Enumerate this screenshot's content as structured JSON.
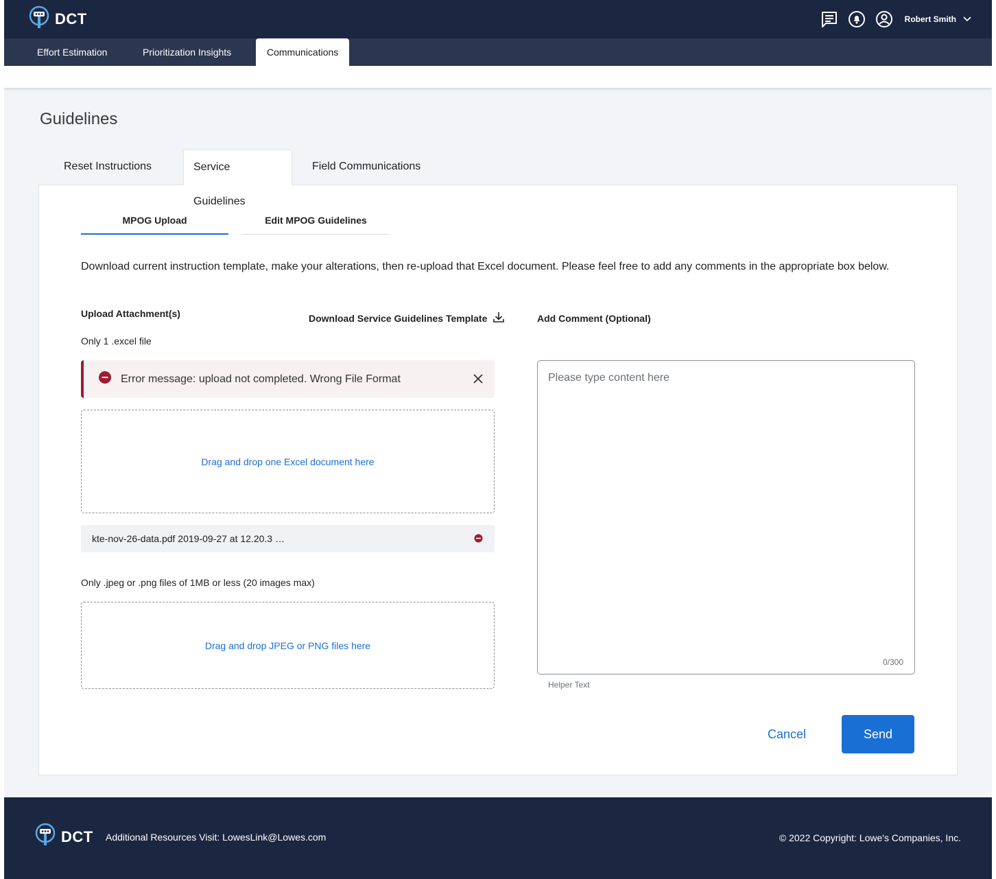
{
  "app": {
    "name": "DCT"
  },
  "header": {
    "user_name": "Robert Smith",
    "icons": [
      "chat-icon",
      "bell-icon",
      "user-icon",
      "chevron-down-icon"
    ]
  },
  "nav": {
    "tabs": [
      {
        "label": "Effort Estimation",
        "active": false
      },
      {
        "label": "Prioritization Insights",
        "active": false
      },
      {
        "label": "Communications",
        "active": true
      }
    ]
  },
  "page": {
    "title": "Guidelines",
    "tabs": [
      {
        "label": "Reset Instructions",
        "active": false
      },
      {
        "label": "Service Guidelines",
        "active": true
      },
      {
        "label": "Field Communications",
        "active": false
      }
    ],
    "subtabs": [
      {
        "label": "MPOG Upload",
        "active": true
      },
      {
        "label": "Edit MPOG Guidelines",
        "active": false
      }
    ],
    "description": "Download current instruction template, make your alterations, then re-upload that Excel document. Please feel free to add any comments in the appropriate box below."
  },
  "upload": {
    "title": "Upload Attachment(s)",
    "excel_hint": "Only 1 .excel file",
    "error_message": "Error message: upload not completed. Wrong File Format",
    "excel_drop_label": "Drag and drop one Excel document here",
    "file_name": "kte-nov-26-data.pdf 2019-09-27 at 12.20.3 …",
    "image_hint": "Only .jpeg or .png files of 1MB or less (20 images max)",
    "image_drop_label": "Drag and drop JPEG or PNG files here"
  },
  "download": {
    "label": "Download Service Guidelines Template"
  },
  "comment": {
    "title": "Add Comment (Optional)",
    "placeholder": "Please type content here",
    "counter": "0/300",
    "helper": "Helper Text"
  },
  "actions": {
    "cancel_label": "Cancel",
    "send_label": "Send"
  },
  "footer": {
    "resources": "Additional Resources Visit: LowesLink@Lowes.com",
    "copyright": "© 2022 Copyright: Lowe's Companies, Inc."
  },
  "colors": {
    "header_bg": "#1b2741",
    "nav_bg": "#2b3650",
    "accent": "#1a6fd4",
    "error": "#9e1b32"
  }
}
